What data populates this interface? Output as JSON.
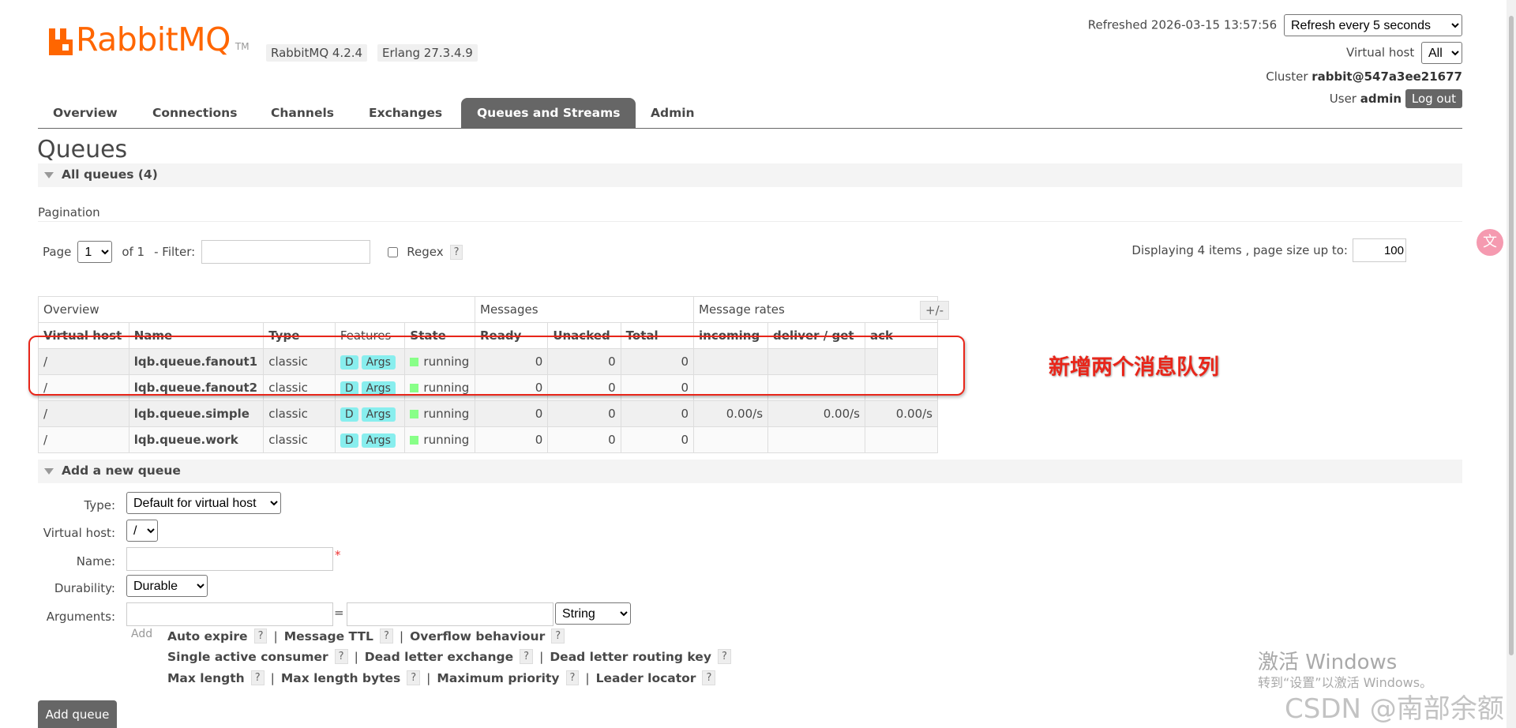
{
  "header": {
    "logo_text": "RabbitMQ",
    "logo_tm": "TM",
    "version": "RabbitMQ 4.2.4",
    "erlang": "Erlang 27.3.4.9",
    "refreshed_label": "Refreshed 2026-03-15 13:57:56",
    "refresh_select": "Refresh every 5 seconds",
    "vhost_label": "Virtual host",
    "vhost_select": "All",
    "cluster_label": "Cluster",
    "cluster_name": "rabbit@547a3ee21677",
    "user_label": "User",
    "user_name": "admin",
    "logout": "Log out"
  },
  "tabs": [
    "Overview",
    "Connections",
    "Channels",
    "Exchanges",
    "Queues and Streams",
    "Admin"
  ],
  "page": {
    "title": "Queues",
    "all_queues": "All queues (4)",
    "pagination_label": "Pagination",
    "page_label": "Page",
    "page_value": "1",
    "of_label": "of 1",
    "filter_label": "- Filter:",
    "regex_label": "Regex",
    "help": "?",
    "displaying": "Displaying 4 items , page size up to:",
    "page_size": "100"
  },
  "table": {
    "group_headers": [
      "Overview",
      "Messages",
      "Message rates"
    ],
    "plusminus": "+/-",
    "columns": [
      "Virtual host",
      "Name",
      "Type",
      "Features",
      "State",
      "Ready",
      "Unacked",
      "Total",
      "incoming",
      "deliver / get",
      "ack"
    ],
    "feature_d": "D",
    "feature_args": "Args",
    "rows": [
      {
        "vhost": "/",
        "name": "lqb.queue.fanout1",
        "type": "classic",
        "state": "running",
        "ready": "0",
        "unacked": "0",
        "total": "0",
        "incoming": "",
        "deliver": "",
        "ack": ""
      },
      {
        "vhost": "/",
        "name": "lqb.queue.fanout2",
        "type": "classic",
        "state": "running",
        "ready": "0",
        "unacked": "0",
        "total": "0",
        "incoming": "",
        "deliver": "",
        "ack": ""
      },
      {
        "vhost": "/",
        "name": "lqb.queue.simple",
        "type": "classic",
        "state": "running",
        "ready": "0",
        "unacked": "0",
        "total": "0",
        "incoming": "0.00/s",
        "deliver": "0.00/s",
        "ack": "0.00/s"
      },
      {
        "vhost": "/",
        "name": "lqb.queue.work",
        "type": "classic",
        "state": "running",
        "ready": "0",
        "unacked": "0",
        "total": "0",
        "incoming": "",
        "deliver": "",
        "ack": ""
      }
    ]
  },
  "annotation": {
    "text": "新增两个消息队列",
    "color": "#e8261a"
  },
  "add_queue": {
    "section_label": "Add a new queue",
    "type_label": "Type:",
    "type_value": "Default for virtual host",
    "vhost_label": "Virtual host:",
    "vhost_value": "/",
    "name_label": "Name:",
    "required_mark": "*",
    "durability_label": "Durability:",
    "durability_value": "Durable",
    "arguments_label": "Arguments:",
    "equals": "=",
    "arg_type": "String",
    "add_label": "Add",
    "links_row1": [
      "Auto expire",
      "Message TTL",
      "Overflow behaviour"
    ],
    "links_row2": [
      "Single active consumer",
      "Dead letter exchange",
      "Dead letter routing key"
    ],
    "links_row3": [
      "Max length",
      "Max length bytes",
      "Maximum priority",
      "Leader locator"
    ],
    "sep": "|",
    "submit": "Add queue"
  },
  "watermark": {
    "win_title": "激活 Windows",
    "win_sub": "转到“设置”以激活 Windows。",
    "csdn": "CSDN @南部余额"
  },
  "colors": {
    "brand": "#ff6600",
    "active_tab": "#666666",
    "running": "#88ff88",
    "feature_badge": "#88eeee"
  }
}
